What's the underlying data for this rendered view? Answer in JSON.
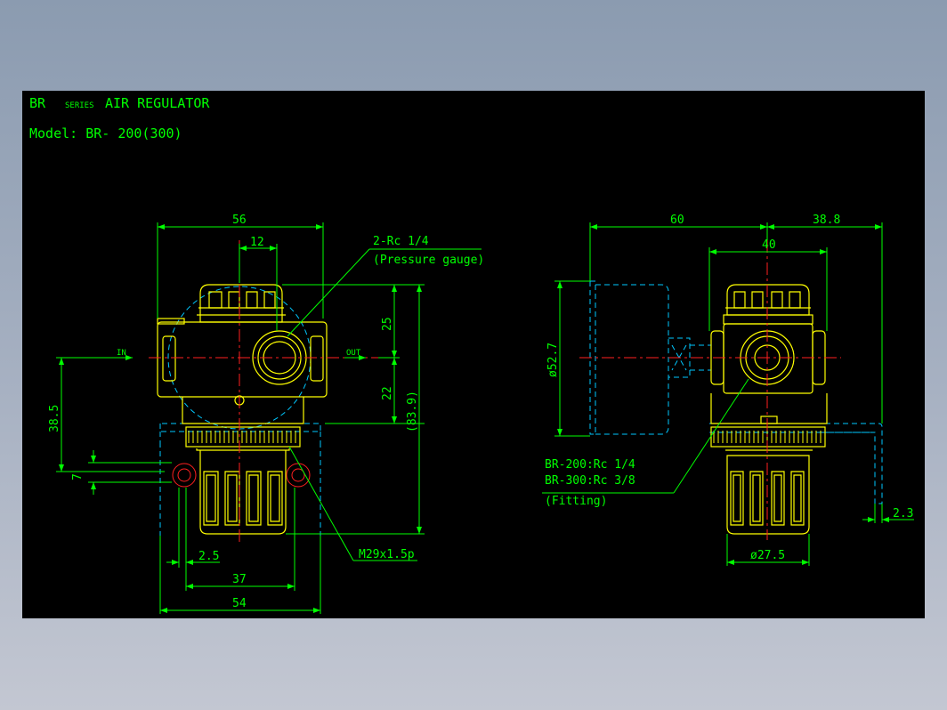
{
  "header": {
    "series_prefix": "BR",
    "series_word": "SERIES",
    "product": "AIR REGULATOR",
    "model": "Model: BR- 200(300)"
  },
  "front_view": {
    "dims": {
      "width_56": "56",
      "port_12": "12",
      "upper_25": "25",
      "lower_22": "22",
      "total_83_9": "(83.9)",
      "height_38_5": "38.5",
      "small_7": "7",
      "offset_2_5": "2.5",
      "width_37": "37",
      "width_54": "54"
    },
    "labels": {
      "in": "IN",
      "out": "OUT",
      "gauge_port": "2-Rc 1/4",
      "gauge_note": "(Pressure gauge)",
      "thread": "M29x1.5p"
    }
  },
  "side_view": {
    "dims": {
      "width_60": "60",
      "width_38_8": "38.8",
      "width_40": "40",
      "dia_52_7": "ø52.7",
      "dia_27_5": "ø27.5",
      "offset_2_3": "2.3"
    },
    "labels": {
      "fitting_200": "BR-200:Rc 1/4",
      "fitting_300": "BR-300:Rc 3/8",
      "fitting_note": "(Fitting)"
    }
  },
  "colors": {
    "background": "#000000",
    "dimension": "#00ff00",
    "outline": "#ffff00",
    "hidden": "#00c8ff",
    "centerline": "#ff2020",
    "window_gradient_top": "#8b9bb0",
    "window_gradient_bottom": "#c3c7d2"
  }
}
